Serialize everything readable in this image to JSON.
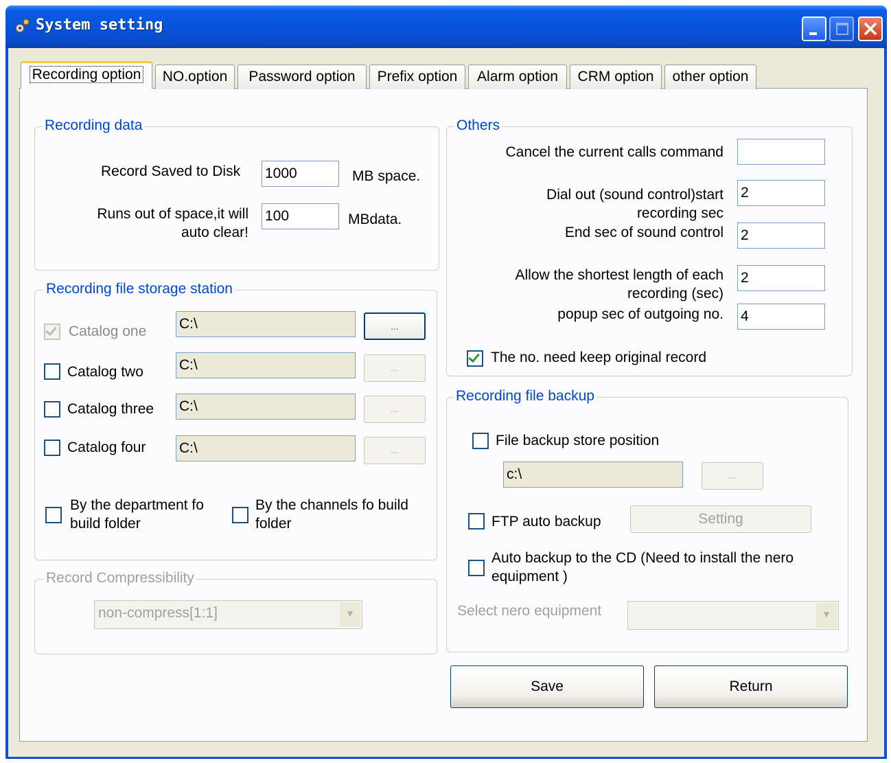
{
  "window": {
    "title": "System setting"
  },
  "tabs": [
    "Recording option",
    "NO.option",
    "Password option",
    "Prefix option",
    "Alarm option",
    "CRM option",
    "other option"
  ],
  "recording_data": {
    "title": "Recording data",
    "saved_label": "Record Saved to Disk",
    "saved_value": "1000",
    "saved_unit": "MB space.",
    "runs_label_1": "Runs out of space,it will",
    "runs_label_2": "auto clear!",
    "runs_value": "100",
    "runs_unit": "MBdata."
  },
  "storage": {
    "title": "Recording file storage station",
    "catalogs": [
      {
        "label": "Catalog one",
        "path": "C:\\",
        "checked": true
      },
      {
        "label": "Catalog two",
        "path": "C:\\",
        "checked": false
      },
      {
        "label": "Catalog three",
        "path": "C:\\",
        "checked": false
      },
      {
        "label": "Catalog four",
        "path": "C:\\",
        "checked": false
      }
    ],
    "browse": "...",
    "dept_1": "By the department fo",
    "dept_2": "build folder",
    "chan_1": "By the channels fo build",
    "chan_2": "folder"
  },
  "compress": {
    "title": "Record Compressibility",
    "value": "non-compress[1:1]"
  },
  "others": {
    "title": "Others",
    "cancel_label": "Cancel the current calls command",
    "cancel_value": "",
    "dial_1": "Dial out (sound control)start",
    "dial_2": "recording sec",
    "dial_value": "2",
    "end_label": "End sec of sound control",
    "end_value": "2",
    "allow_1": "Allow the shortest length of each",
    "allow_2": "recording (sec)",
    "allow_value": "2",
    "popup_label": "popup sec of outgoing no.",
    "popup_value": "4",
    "keep_label": "The no. need keep original record",
    "keep_checked": true
  },
  "backup": {
    "title": "Recording file backup",
    "store_label": "File backup store position",
    "store_path": "c:\\",
    "browse": "...",
    "ftp_label": "FTP auto backup",
    "setting": "Setting",
    "cd_1": "Auto backup to the CD (Need to install the nero",
    "cd_2": "equipment )",
    "nero_label": "Select nero equipment",
    "nero_value": ""
  },
  "buttons": {
    "save": "Save",
    "return": "Return"
  }
}
